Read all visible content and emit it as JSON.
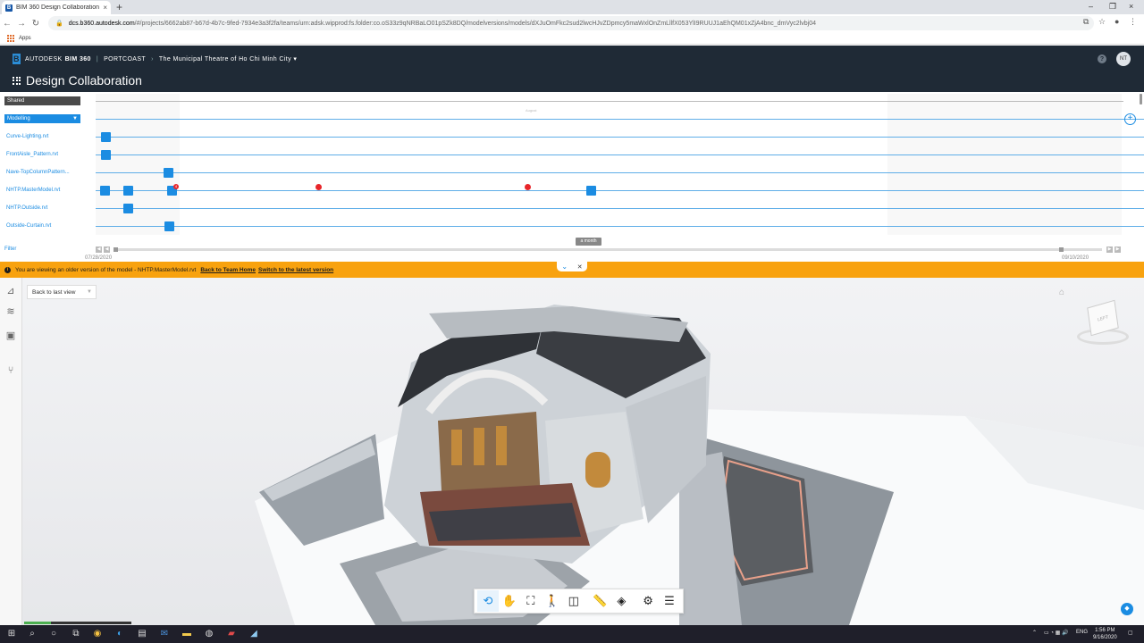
{
  "browser": {
    "tab_title": "BIM 360 Design Collaboration",
    "tab_close": "×",
    "new_tab": "+",
    "minimize": "–",
    "restore": "❐",
    "close": "×",
    "url_host": "dcs.b360.autodesk.com",
    "url_path": "/#/projects/6662ab87-b67d-4b7c-9fed-7934e3a3f2fa/teams/urn:adsk.wipprod:fs.folder:co.oS33z9qNRBaLO01pSZk8DQ/modelversions/models/dXJuOmFkc2sud2lwcHJvZDpmcy5maWxlOnZmLllfX053YlI9RUUJ1aEhQM01xZjA4bnc_dmVyc2lvbj04",
    "bookmarks_label": "Apps"
  },
  "header": {
    "brand": "AUTODESK",
    "product": "BIM 360",
    "project_company": "PORTCOAST",
    "project_name": "The Municipal Theatre of Ho Chi Minh City",
    "app_title": "Design Collaboration",
    "help": "?",
    "user_initials": "NT"
  },
  "timeline": {
    "shared_label": "Shared",
    "folder": "Modelling",
    "month_marker": "August",
    "files": [
      "Curve-Lighting.rvt",
      "FrontAisle_Pattern.rvt",
      "Nave-TopColumnPattern...",
      "NHTP.MasterModel.rvt",
      "NHTP.Outside.rvt",
      "Outside-Curtain.rvt"
    ],
    "filter": "Filter",
    "badge_count": "4",
    "range_label": "a month",
    "start_date": "07/28/2020",
    "end_date": "09/10/2020"
  },
  "banner": {
    "message": "You are viewing an older version of the model - NHTP.MasterModel.rvt",
    "back_link": "Back to Team Home",
    "latest_link": "Switch to the latest version"
  },
  "viewer": {
    "back_to_last_view": "Back to last view",
    "viewcube_face": "LEFT",
    "load_progress": 0.25
  },
  "taskbar": {
    "lang": "ENG",
    "time": "1:56 PM",
    "date": "9/16/2020"
  },
  "colors": {
    "header_bg": "#1f2a36",
    "accent": "#1b8ce2",
    "banner": "#f8a20f",
    "marker_red": "#e8262a"
  }
}
